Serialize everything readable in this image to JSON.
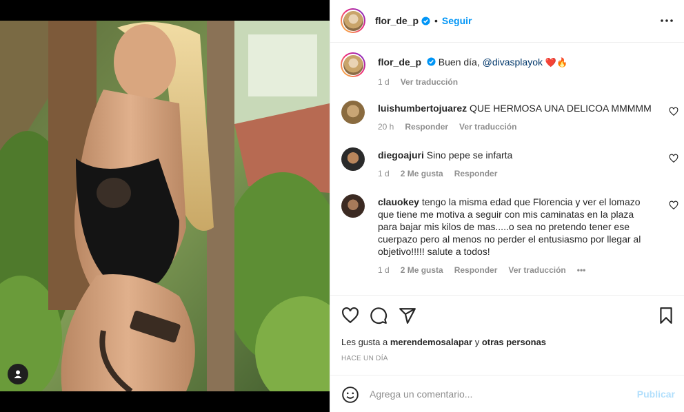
{
  "post": {
    "username": "flor_de_p",
    "follow_label": "Seguir",
    "separator": "•",
    "caption_text": "Buen día,",
    "caption_mention": "@divasplayok",
    "caption_emojis": "❤️🔥",
    "caption_time": "1 d",
    "caption_translate": "Ver traducción"
  },
  "comments": [
    {
      "username": "luishumbertojuarez",
      "text": "QUE HERMOSA UNA DELICOA MMMMM",
      "time": "20 h",
      "reply": "Responder",
      "translate": "Ver traducción"
    },
    {
      "username": "diegoajuri",
      "text": "Sino pepe se infarta",
      "time": "1 d",
      "likes": "2 Me gusta",
      "reply": "Responder"
    },
    {
      "username": "clauokey",
      "text": "tengo la misma edad que Florencia y ver el lomazo que tiene me motiva a seguir con mis caminatas en la plaza para bajar mis kilos de mas.....o sea no pretendo tener ese cuerpazo pero al menos no perder el entusiasmo por llegar al objetivo!!!!! salute a todos!",
      "time": "1 d",
      "likes": "2 Me gusta",
      "reply": "Responder",
      "translate": "Ver traducción",
      "more": "•••"
    }
  ],
  "likes": {
    "prefix": "Les gusta a",
    "user": "merendemosalapar",
    "connector": "y",
    "others": "otras personas"
  },
  "post_date": "HACE UN DÍA",
  "comment_box": {
    "placeholder": "Agrega un comentario...",
    "publish_label": "Publicar"
  },
  "colors": {
    "accent": "#0095f6",
    "heart": "#ed4956",
    "publish_disabled": "#b2dffc",
    "muted": "#8e8e8e"
  }
}
